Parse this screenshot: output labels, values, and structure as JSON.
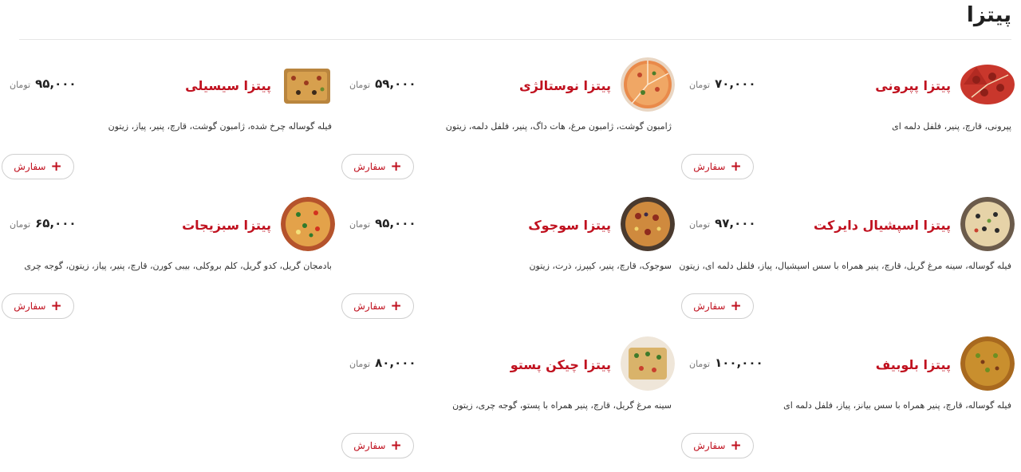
{
  "section": {
    "title": "پیتزا",
    "currency": "تومان",
    "order_label": "سفارش"
  },
  "colors": {
    "accent": "#c0111f",
    "price": "#222222",
    "muted": "#777777"
  },
  "items": [
    {
      "name": "پیتزا پپرونی",
      "price": "۷۰,۰۰۰",
      "description": "پپرونی، قارچ، پنیر، فلفل دلمه ای",
      "image": "pepperoni-pizza-image"
    },
    {
      "name": "پیتزا نوستالژی",
      "price": "۵۹,۰۰۰",
      "description": "ژامبون گوشت، ژامبون مرغ، هات داگ، پنیر، فلفل دلمه، زیتون",
      "image": "nostalgia-pizza-image"
    },
    {
      "name": "پیتزا سیسیلی",
      "price": "۹۵,۰۰۰",
      "description": "فیله گوساله چرخ شده، ژامبون گوشت، قارچ، پنیر، پیاز، زیتون",
      "image": "sicilian-pizza-image"
    },
    {
      "name": "پیتزا اسپشیال دایرکت",
      "price": "۹۷,۰۰۰",
      "description": "فیله گوساله، سینه مرغ گریل، قارچ، پنیر همراه با سس اسپشیال، پیاز، فلفل دلمه ای، زیتون",
      "image": "special-direct-pizza-image"
    },
    {
      "name": "پیتزا سوجوک",
      "price": "۹۵,۰۰۰",
      "description": "سوجوک، قارچ، پنیر، کیپرز، ذرت، زیتون",
      "image": "sujuk-pizza-image"
    },
    {
      "name": "پیتزا سبزیجات",
      "price": "۶۵,۰۰۰",
      "description": "بادمجان گریل، کدو گریل، کلم بروکلی، بیبی کورن، قارچ، پنیر، پیاز، زیتون، گوجه چری",
      "image": "vegetable-pizza-image"
    },
    {
      "name": "پیتزا بلوبیف",
      "price": "۱۰۰,۰۰۰",
      "description": "فیله گوساله، قارچ، پنیر همراه با سس بیانز، پیاز، فلفل دلمه ای",
      "image": "blue-beef-pizza-image"
    },
    {
      "name": "پیتزا چیکن پستو",
      "price": "۸۰,۰۰۰",
      "description": "سینه مرغ گریل، قارچ، پنیر همراه با پستو، گوجه چری، زیتون",
      "image": "chicken-pesto-pizza-image"
    }
  ]
}
